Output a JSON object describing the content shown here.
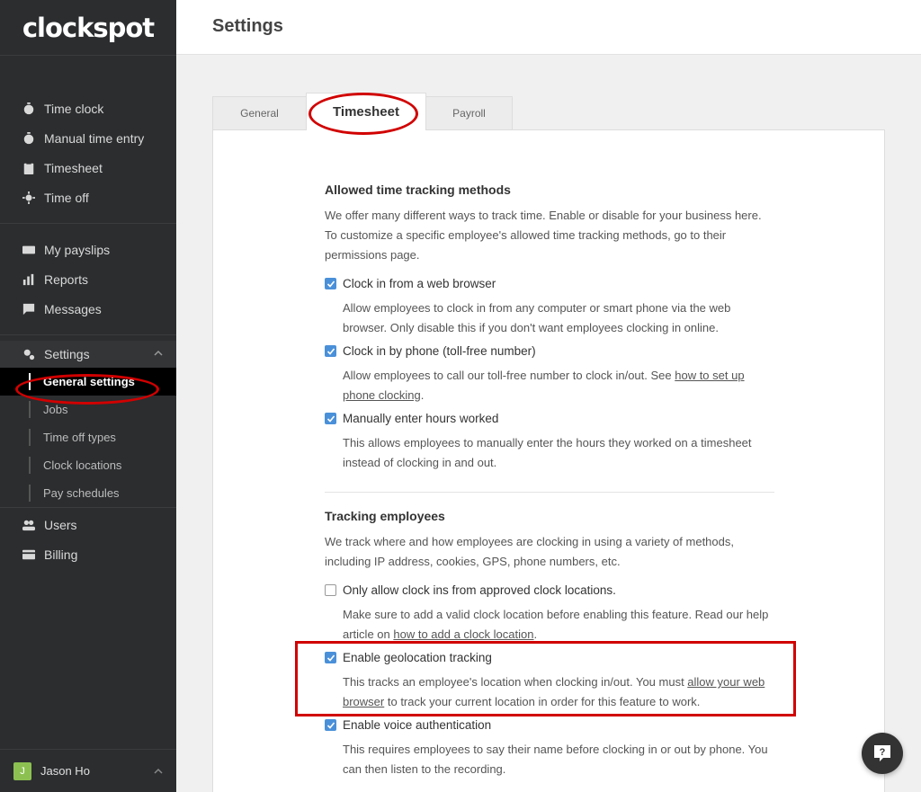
{
  "app": {
    "logo": "clockspot",
    "page_title": "Settings"
  },
  "sidebar": {
    "group1": [
      {
        "label": "Time clock",
        "icon": "stopwatch-icon"
      },
      {
        "label": "Manual time entry",
        "icon": "stopwatch-icon"
      },
      {
        "label": "Timesheet",
        "icon": "clipboard-icon"
      },
      {
        "label": "Time off",
        "icon": "sun-icon"
      }
    ],
    "group2": [
      {
        "label": "My payslips",
        "icon": "payslip-icon"
      },
      {
        "label": "Reports",
        "icon": "bar-chart-icon"
      },
      {
        "label": "Messages",
        "icon": "message-icon"
      }
    ],
    "settings": {
      "label": "Settings",
      "subitems": [
        "General settings",
        "Jobs",
        "Time off types",
        "Clock locations",
        "Pay schedules"
      ]
    },
    "users": "Users",
    "billing": "Billing",
    "user": {
      "initial": "J",
      "name": "Jason Ho"
    }
  },
  "tabs": [
    "General",
    "Timesheet",
    "Payroll"
  ],
  "sections": {
    "allowed": {
      "title": "Allowed time tracking methods",
      "description": "We offer many different ways to track time. Enable or disable for your business here. To customize a specific employee's allowed time tracking methods, go to their permissions page.",
      "options": [
        {
          "label": "Clock in from a web browser",
          "checked": true,
          "desc": "Allow employees to clock in from any computer or smart phone via the web browser. Only disable this if you don't want employees clocking in online."
        },
        {
          "label": "Clock in by phone (toll-free number)",
          "checked": true,
          "desc_pre": "Allow employees to call our toll-free number to clock in/out. See ",
          "desc_link": "how to set up phone clocking",
          "desc_post": "."
        },
        {
          "label": "Manually enter hours worked",
          "checked": true,
          "desc": "This allows employees to manually enter the hours they worked on a timesheet instead of clocking in and out."
        }
      ]
    },
    "tracking": {
      "title": "Tracking employees",
      "description": "We track where and how employees are clocking in using a variety of methods, including IP address, cookies, GPS, phone numbers, etc.",
      "options": [
        {
          "label": "Only allow clock ins from approved clock locations.",
          "checked": false,
          "desc_pre": "Make sure to add a valid clock location before enabling this feature. Read our help article on ",
          "desc_link": "how to add a clock location",
          "desc_post": "."
        },
        {
          "label": "Enable geolocation tracking",
          "checked": true,
          "desc_pre": "This tracks an employee's location when clocking in/out. You must ",
          "desc_link": "allow your web browser",
          "desc_post": " to track your current location in order for this feature to work."
        },
        {
          "label": "Enable voice authentication",
          "checked": true,
          "desc": "This requires employees to say their name before clocking in or out by phone. You can then listen to the recording."
        }
      ]
    }
  },
  "colors": {
    "sidebar_bg": "#2b2d2f",
    "accent": "#4a90d9",
    "highlight": "#d10000"
  }
}
